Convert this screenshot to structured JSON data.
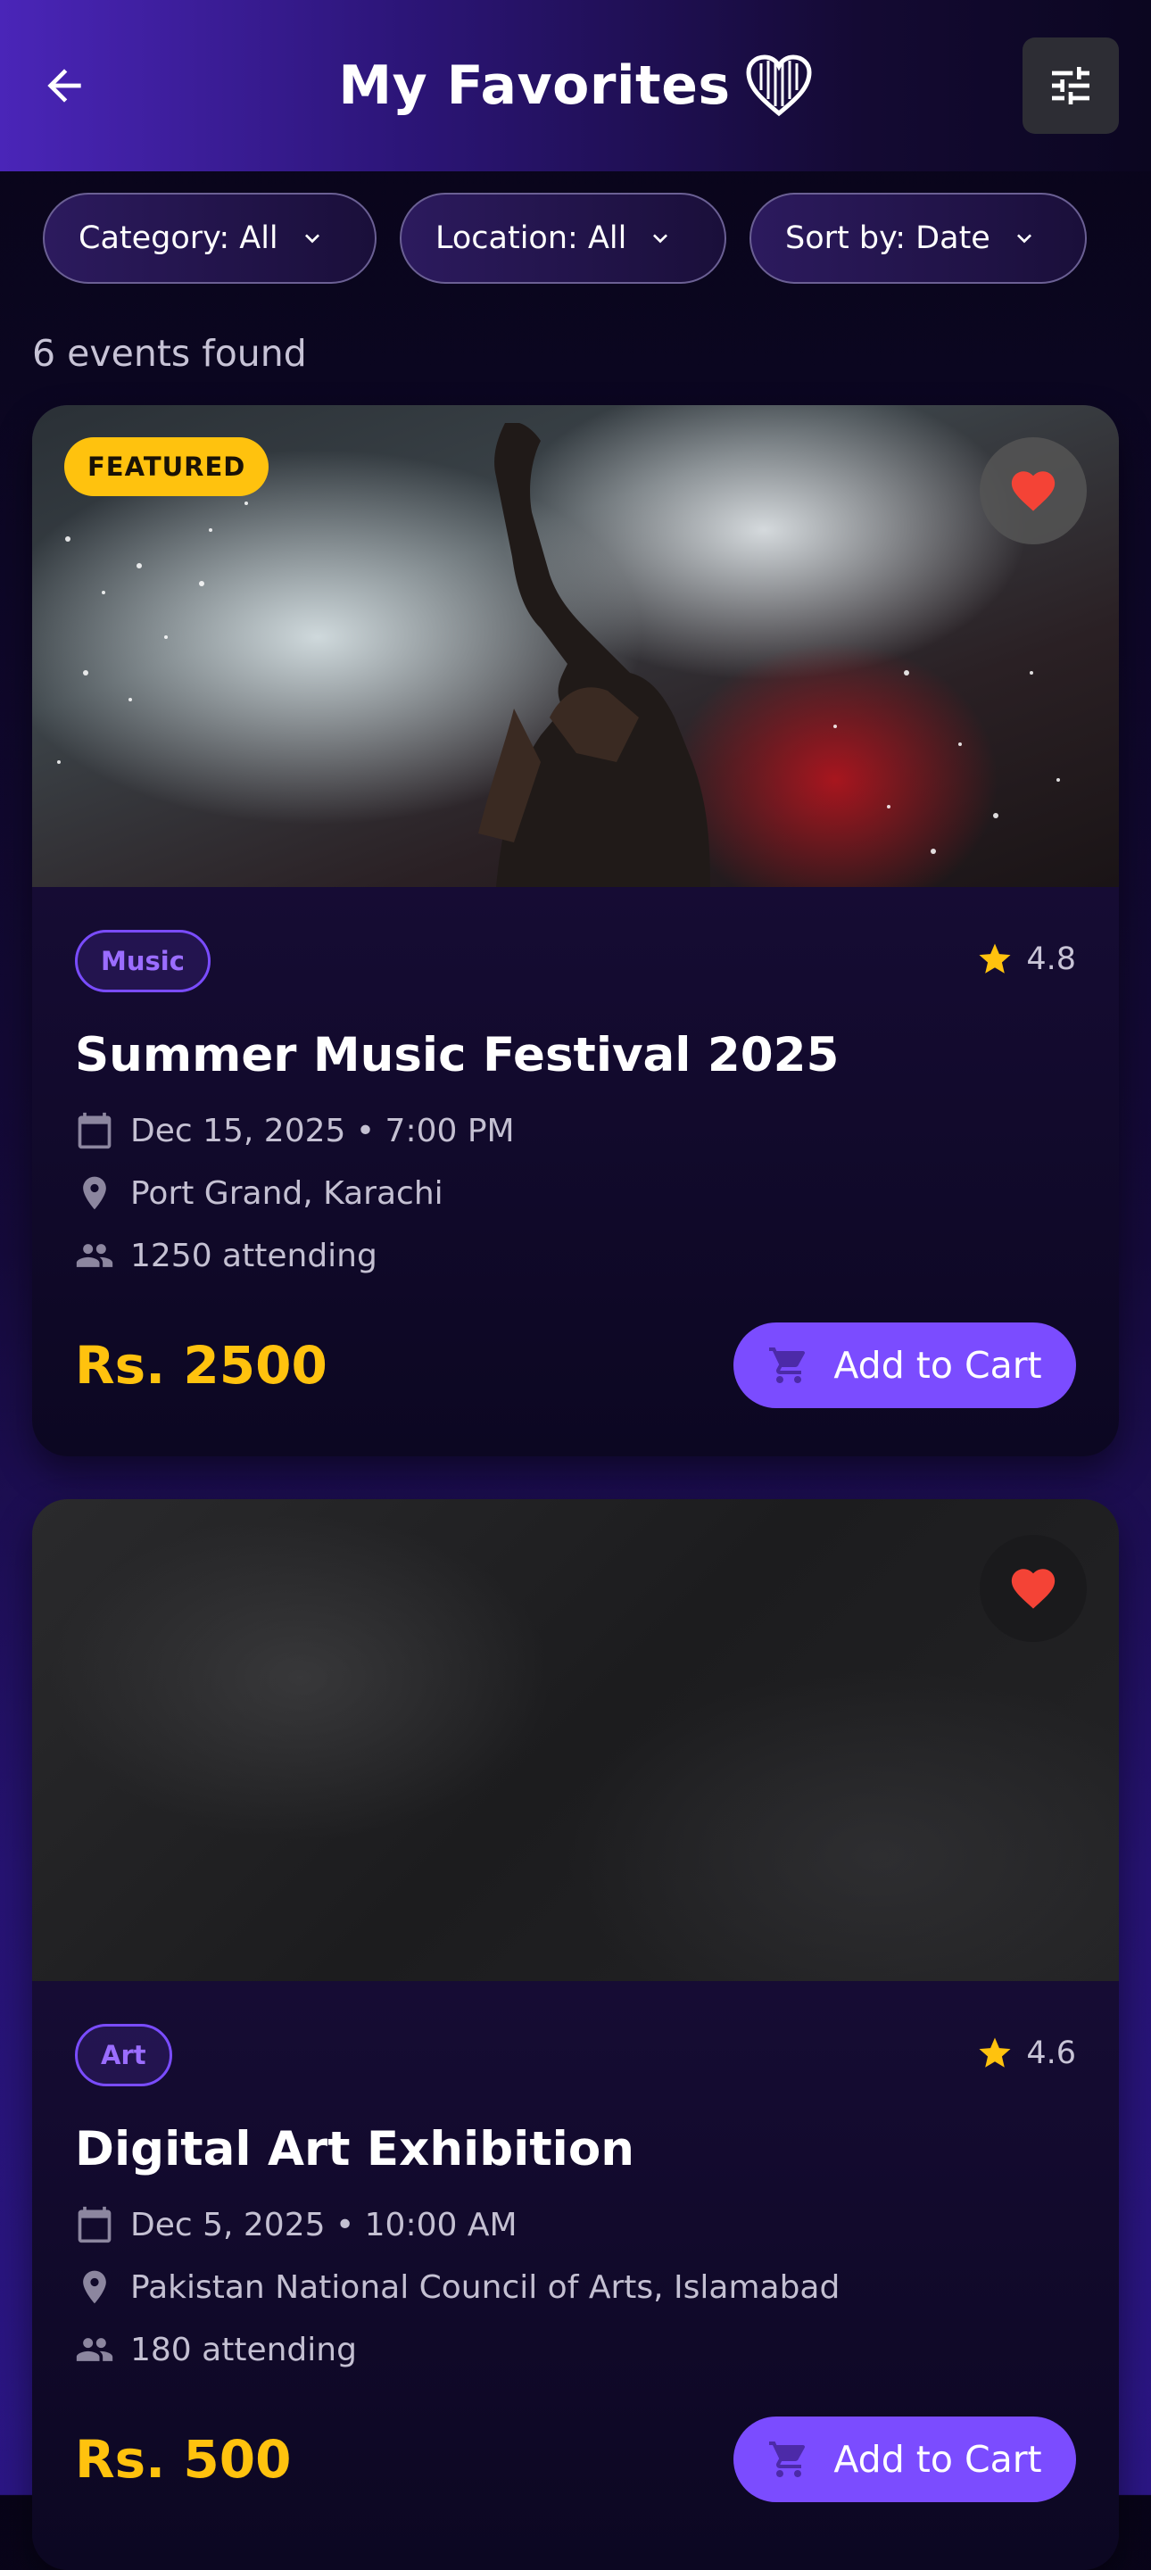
{
  "header": {
    "title": "My Favorites",
    "back_icon": "arrow-left-icon",
    "title_icon": "heart-outline-icon",
    "filter_icon": "tune-sliders-icon"
  },
  "filters": [
    {
      "label": "Category: All"
    },
    {
      "label": "Location: All"
    },
    {
      "label": "Sort by: Date"
    }
  ],
  "results": {
    "count_text": "6 events found"
  },
  "colors": {
    "accent": "#7b4cff",
    "price": "#ffc20e",
    "favorite_heart": "#f44336",
    "featured_badge": "#ffc20e"
  },
  "events": [
    {
      "featured_label": "FEATURED",
      "category": "Music",
      "rating": "4.8",
      "title": "Summer Music Festival 2025",
      "datetime": "Dec 15, 2025 • 7:00 PM",
      "location": "Port Grand, Karachi",
      "attending": "1250 attending",
      "price": "Rs. 2500",
      "cart_label": "Add to Cart",
      "favorited": true
    },
    {
      "category": "Art",
      "rating": "4.6",
      "title": "Digital Art Exhibition",
      "datetime": "Dec 5, 2025 • 10:00 AM",
      "location": "Pakistan National Council of Arts, Islamabad",
      "attending": "180 attending",
      "price": "Rs. 500",
      "cart_label": "Add to Cart",
      "favorited": true
    }
  ]
}
